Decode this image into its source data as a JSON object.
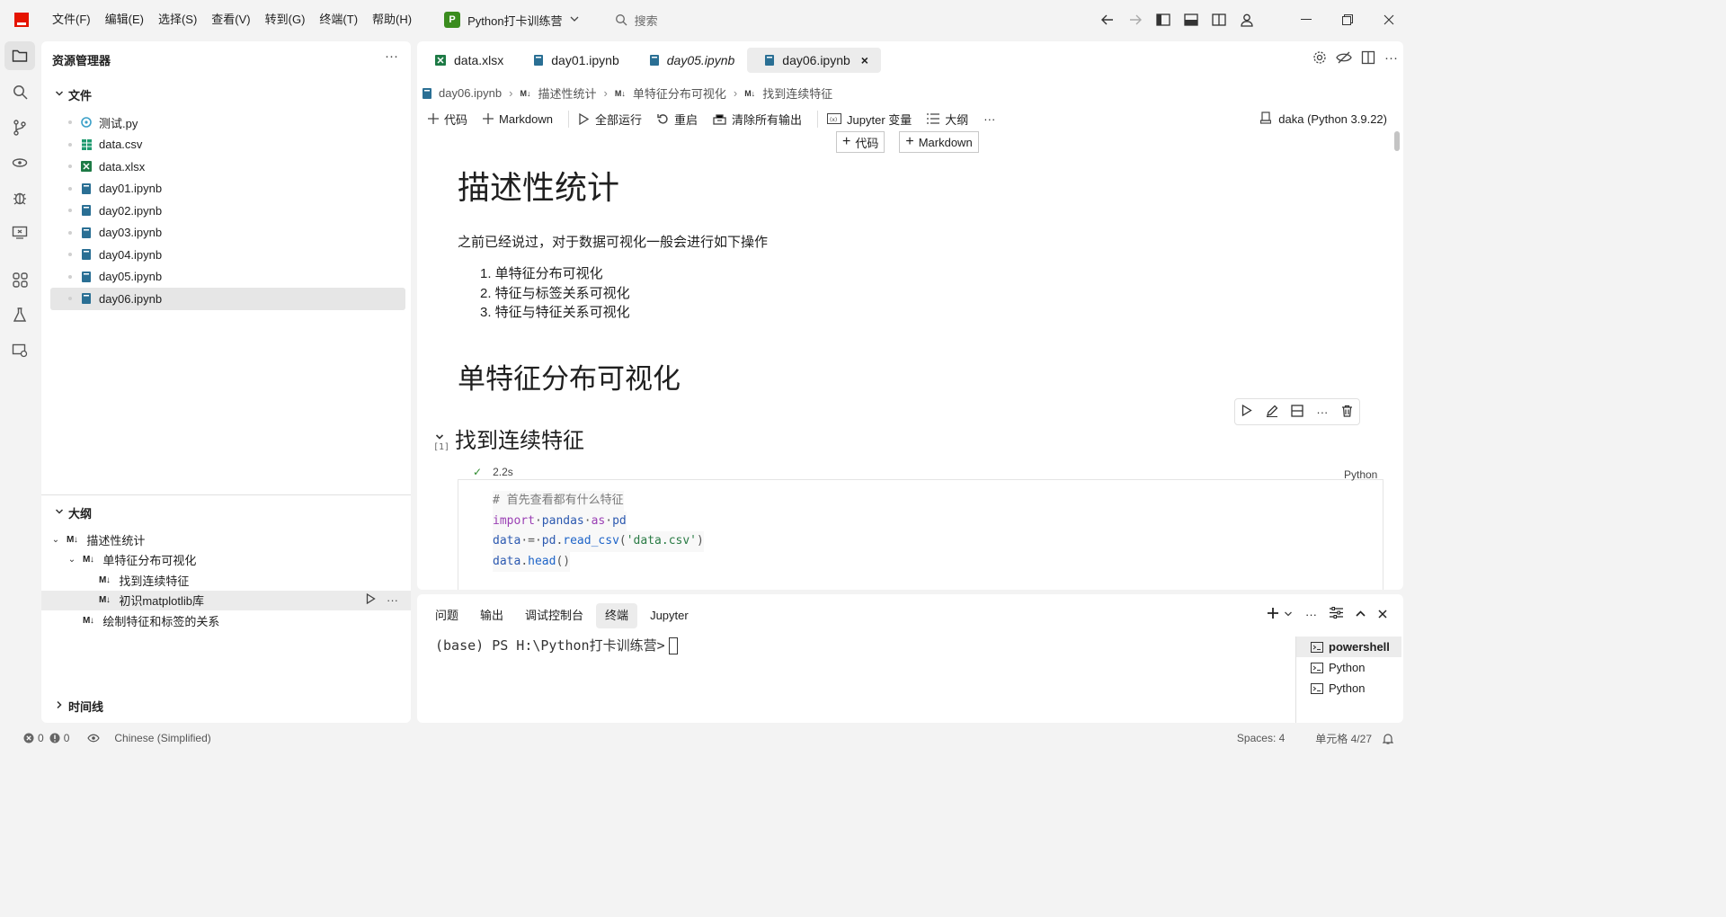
{
  "menu": [
    "文件(F)",
    "编辑(E)",
    "选择(S)",
    "查看(V)",
    "转到(G)",
    "终端(T)",
    "帮助(H)"
  ],
  "project": {
    "badge": "P",
    "name": "Python打卡训练营"
  },
  "search": {
    "placeholder": "搜索"
  },
  "explorer": {
    "title": "资源管理器",
    "files_section": "文件",
    "files": [
      {
        "name": "测试.py",
        "icon": "python-icon"
      },
      {
        "name": "data.csv",
        "icon": "csv-icon"
      },
      {
        "name": "data.xlsx",
        "icon": "excel-icon"
      },
      {
        "name": "day01.ipynb",
        "icon": "notebook-icon"
      },
      {
        "name": "day02.ipynb",
        "icon": "notebook-icon"
      },
      {
        "name": "day03.ipynb",
        "icon": "notebook-icon"
      },
      {
        "name": "day04.ipynb",
        "icon": "notebook-icon"
      },
      {
        "name": "day05.ipynb",
        "icon": "notebook-icon"
      },
      {
        "name": "day06.ipynb",
        "icon": "notebook-icon",
        "selected": true
      }
    ]
  },
  "outline": {
    "title": "大纲",
    "md_badge": "M↓",
    "items": [
      {
        "label": "描述性统计",
        "level": 0,
        "expanded": true
      },
      {
        "label": "单特征分布可视化",
        "level": 1,
        "expanded": true
      },
      {
        "label": "找到连续特征",
        "level": 2
      },
      {
        "label": "初识matplotlib库",
        "level": 2,
        "highlighted": true
      },
      {
        "label": "绘制特征和标签的关系",
        "level": 1
      }
    ]
  },
  "timeline": {
    "title": "时间线"
  },
  "tabs": [
    {
      "label": "data.xlsx",
      "icon": "excel-icon"
    },
    {
      "label": "day01.ipynb",
      "icon": "notebook-icon"
    },
    {
      "label": "day05.ipynb",
      "icon": "notebook-icon",
      "italic": true
    },
    {
      "label": "day06.ipynb",
      "icon": "notebook-icon",
      "active": true,
      "close": "×"
    }
  ],
  "breadcrumb": [
    "day06.ipynb",
    "描述性统计",
    "单特征分布可视化",
    "找到连续特征"
  ],
  "notebook_toolbar": {
    "code": "代码",
    "markdown": "Markdown",
    "run_all": "全部运行",
    "restart": "重启",
    "clear_outputs": "清除所有输出",
    "variables": "Jupyter 变量",
    "outline": "大纲",
    "more": "···",
    "kernel": "daka (Python 3.9.22)"
  },
  "insert": {
    "code": "代码",
    "markdown": "Markdown"
  },
  "notebook": {
    "h1": "描述性统计",
    "paragraph": "之前已经说过，对于数据可视化一般会进行如下操作",
    "list": [
      "1. 单特征分布可视化",
      "2. 特征与标签关系可视化",
      "3. 特征与特征关系可视化"
    ],
    "h2": "单特征分布可视化",
    "h3": "找到连续特征",
    "code": {
      "comment": "# 首先查看都有什么特征",
      "l2": {
        "kw1": "import",
        "mod": "pandas",
        "kw2": "as",
        "alias": "pd"
      },
      "l3": {
        "var": "data",
        "eq": "=",
        "obj": "pd",
        "dot": ".",
        "fn": "read_csv",
        "open": "(",
        "str": "'data.csv'",
        "close": ")"
      },
      "l4": {
        "var": "data",
        "dot": ".",
        "fn": "head",
        "paren": "()"
      }
    },
    "exec_count": "[1]",
    "duration": "2.2s",
    "language": "Python"
  },
  "panel": {
    "tabs": [
      "问题",
      "输出",
      "调试控制台",
      "终端",
      "Jupyter"
    ],
    "active": "终端",
    "prompt": "(base) PS H:\\Python打卡训练营>",
    "terminals": [
      {
        "name": "powershell",
        "active": true
      },
      {
        "name": "Python"
      },
      {
        "name": "Python"
      }
    ],
    "more": "···"
  },
  "status": {
    "errors": "0",
    "warnings": "0",
    "language": "Chinese (Simplified)",
    "spaces": "Spaces: 4",
    "cell": "单元格 4/27"
  },
  "colors": {
    "accent": "#e51400",
    "project": "#3a8c1e",
    "ok": "#2e8b2e"
  }
}
